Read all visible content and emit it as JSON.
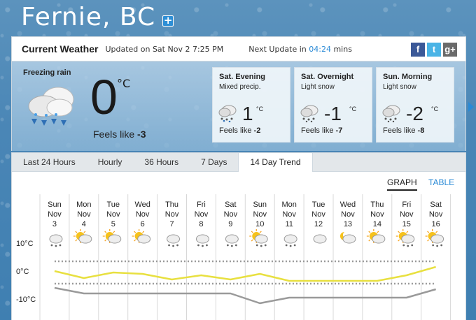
{
  "location": {
    "city": "Fernie, BC",
    "add_label": "+"
  },
  "current_bar": {
    "title": "Current Weather",
    "updated": "Updated on Sat Nov 2 7:25 PM",
    "next_update_label": "Next Update in",
    "next_update_value": "04:24",
    "next_update_unit": "mins",
    "social": {
      "facebook": "f",
      "twitter": "t",
      "google": "g+"
    }
  },
  "current": {
    "condition": "Freezing rain",
    "temp": "0",
    "unit": "°C",
    "feels_label": "Feels like",
    "feels_value": "-3",
    "icon": "freezing-rain-icon"
  },
  "forecast": [
    {
      "period": "Sat. Evening",
      "condition": "Mixed precip.",
      "temp": "1",
      "unit": "°C",
      "feels_label": "Feels like",
      "feels_value": "-2",
      "icon": "mixed-precip-icon"
    },
    {
      "period": "Sat. Overnight",
      "condition": "Light snow",
      "temp": "-1",
      "unit": "°C",
      "feels_label": "Feels like",
      "feels_value": "-7",
      "icon": "snow-icon"
    },
    {
      "period": "Sun. Morning",
      "condition": "Light snow",
      "temp": "-2",
      "unit": "°C",
      "feels_label": "Feels like",
      "feels_value": "-8",
      "icon": "snow-icon"
    }
  ],
  "tabs": [
    "Last 24 Hours",
    "Hourly",
    "36 Hours",
    "7 Days",
    "14 Day Trend"
  ],
  "active_tab": "14 Day Trend",
  "view_toggle": {
    "graph": "GRAPH",
    "table": "TABLE",
    "active": "GRAPH"
  },
  "colors": {
    "accent": "#2a8ad6",
    "high_line": "#e8e040",
    "low_line": "#9a9a9a"
  },
  "chart_data": {
    "type": "line",
    "days": [
      {
        "dow": "Sun",
        "mon": "Nov",
        "day": "3",
        "icon": "snow-icon"
      },
      {
        "dow": "Mon",
        "mon": "Nov",
        "day": "4",
        "icon": "sun-cloud-icon"
      },
      {
        "dow": "Tue",
        "mon": "Nov",
        "day": "5",
        "icon": "sun-cloud-icon"
      },
      {
        "dow": "Wed",
        "mon": "Nov",
        "day": "6",
        "icon": "sun-cloud-icon"
      },
      {
        "dow": "Thu",
        "mon": "Nov",
        "day": "7",
        "icon": "snow-icon"
      },
      {
        "dow": "Fri",
        "mon": "Nov",
        "day": "8",
        "icon": "snow-icon"
      },
      {
        "dow": "Sat",
        "mon": "Nov",
        "day": "9",
        "icon": "snow-icon"
      },
      {
        "dow": "Sun",
        "mon": "Nov",
        "day": "10",
        "icon": "sun-snow-icon"
      },
      {
        "dow": "Mon",
        "mon": "Nov",
        "day": "11",
        "icon": "snow-icon"
      },
      {
        "dow": "Tue",
        "mon": "Nov",
        "day": "12",
        "icon": "cloud-icon"
      },
      {
        "dow": "Wed",
        "mon": "Nov",
        "day": "13",
        "icon": "moon-cloud-icon"
      },
      {
        "dow": "Thu",
        "mon": "Nov",
        "day": "14",
        "icon": "sun-cloud-icon"
      },
      {
        "dow": "Fri",
        "mon": "Nov",
        "day": "15",
        "icon": "sun-snow-icon"
      },
      {
        "dow": "Sat",
        "mon": "Nov",
        "day": "16",
        "icon": "sun-snow-icon"
      }
    ],
    "y_ticks": [
      10,
      0,
      -10
    ],
    "y_unit": "°C",
    "ylim": [
      -12,
      12
    ],
    "series": [
      {
        "name": "high",
        "values": [
          0,
          -2.5,
          -0.5,
          -1,
          -3,
          -1.5,
          -3,
          -1,
          -3.5,
          -3.5,
          -3.5,
          -3.5,
          -1.5,
          1.5
        ]
      },
      {
        "name": "low",
        "values": [
          -6,
          -8,
          -8,
          -8,
          -8,
          -8,
          -8,
          -11.5,
          -9.5,
          -9.5,
          -9.5,
          -9.5,
          -9.5,
          -6.5
        ]
      }
    ],
    "reference_lines": [
      3.5,
      -4.5
    ]
  }
}
